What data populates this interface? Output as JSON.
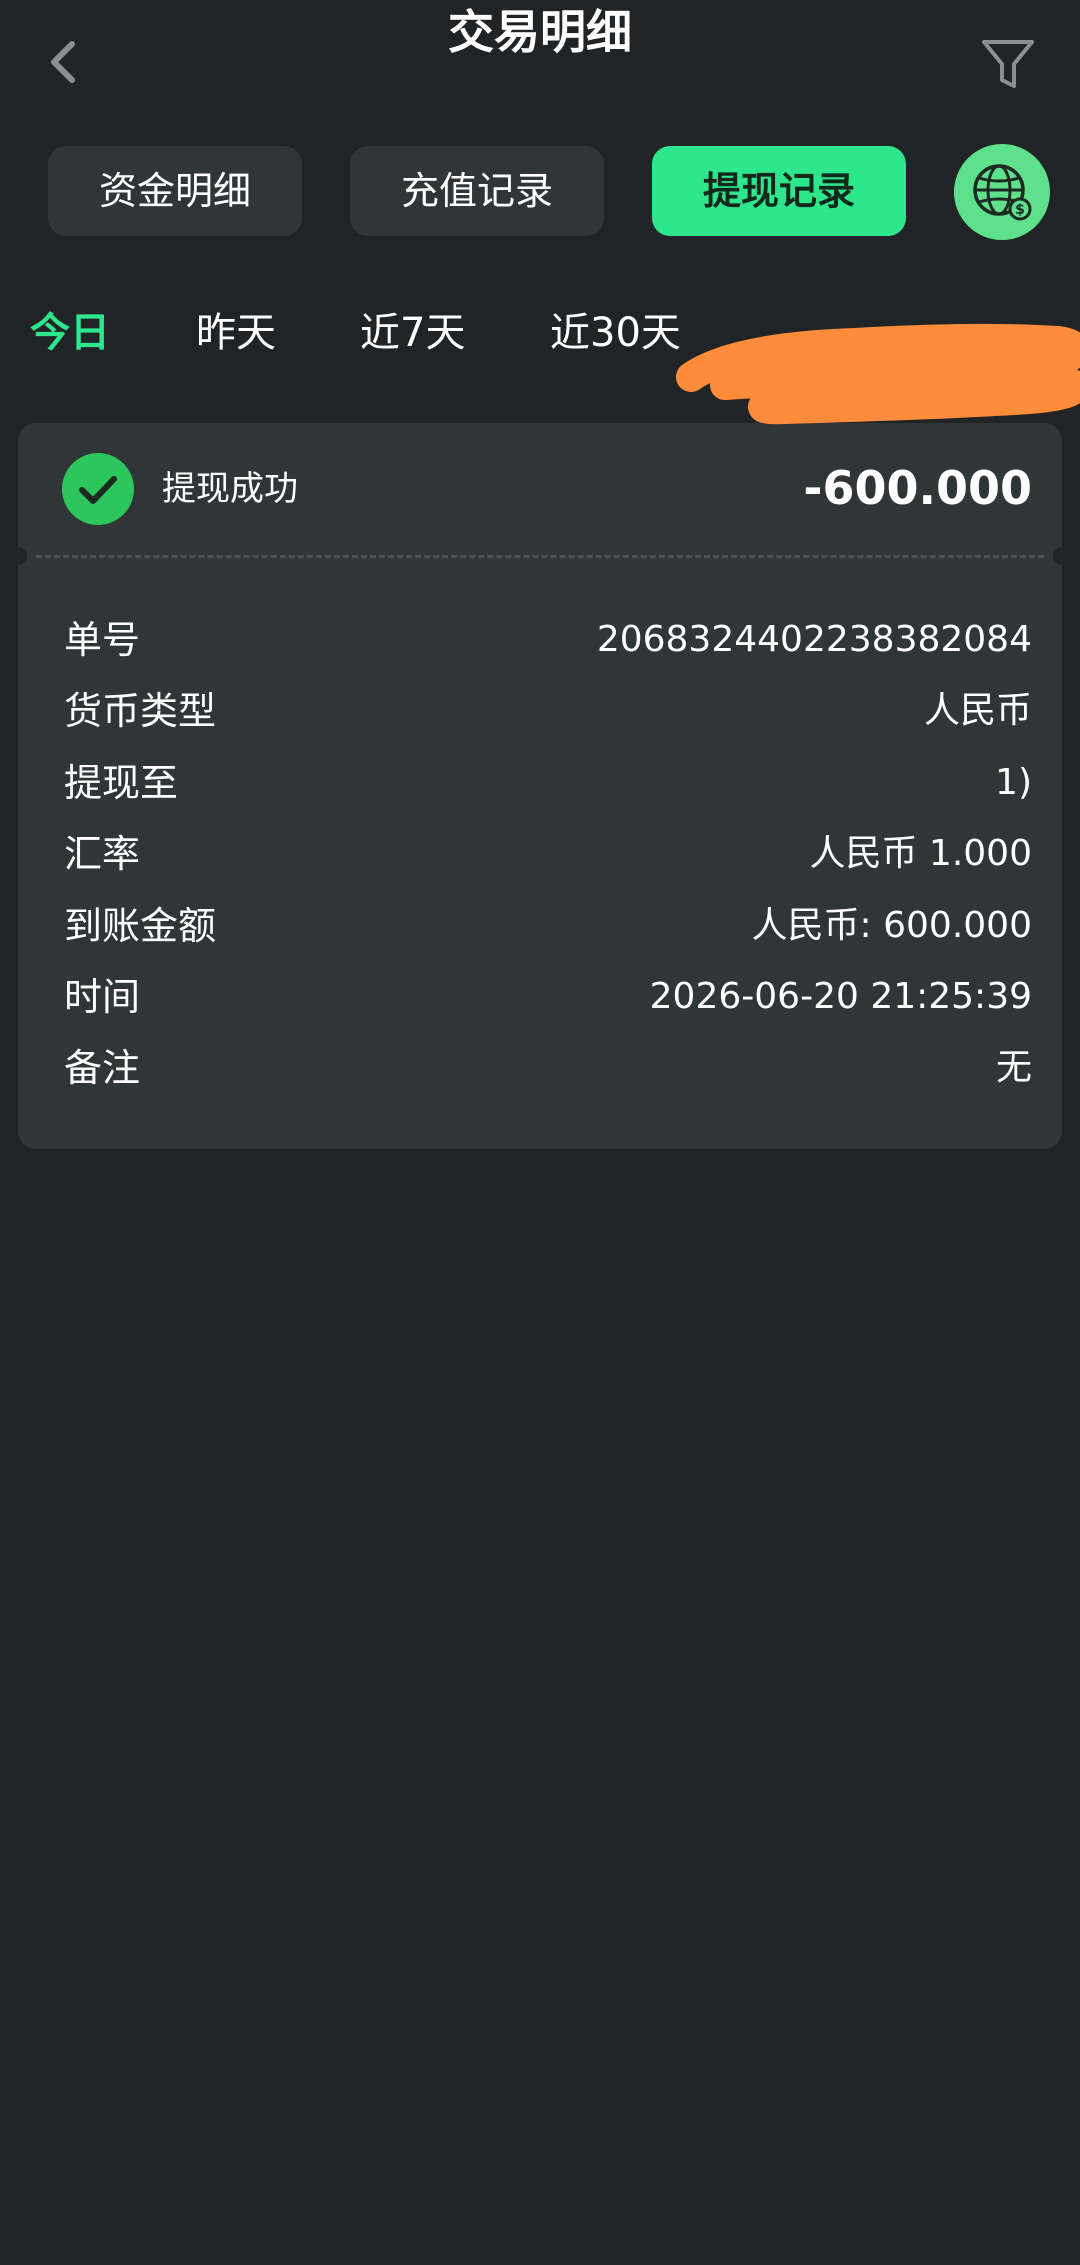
{
  "header": {
    "title": "交易明细",
    "back_icon": "chevron-left-icon",
    "filter_icon": "filter-icon"
  },
  "tabs": [
    {
      "label": "资金明细",
      "active": false
    },
    {
      "label": "充值记录",
      "active": false
    },
    {
      "label": "提现记录",
      "active": true
    }
  ],
  "globe_icon": "globe-settings-icon",
  "date_filter": [
    {
      "label": "今日",
      "active": true
    },
    {
      "label": "昨天",
      "active": false
    },
    {
      "label": "近7天",
      "active": false
    },
    {
      "label": "近30天",
      "active": false
    }
  ],
  "record": {
    "status_icon": "check-circle-icon",
    "status": "提现成功",
    "amount": "-600.000",
    "details": [
      {
        "key": "单号",
        "value": "2068324402238382084"
      },
      {
        "key": "货币类型",
        "value": "人民币"
      },
      {
        "key": "提现至",
        "value": "1)"
      },
      {
        "key": "汇率",
        "value": "人民币 1.000"
      },
      {
        "key": "到账金额",
        "value": "人民币: 600.000"
      },
      {
        "key": "时间",
        "value": "2026-06-20 21:25:39"
      },
      {
        "key": "备注",
        "value": "无"
      }
    ]
  },
  "colors": {
    "background": "#212426",
    "card": "#303538",
    "accent": "#2ee68c",
    "success": "#2dc65c",
    "redaction": "#ff8c3a"
  }
}
